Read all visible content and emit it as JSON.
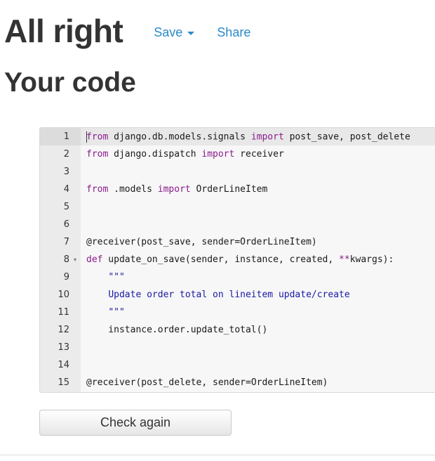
{
  "header": {
    "title": "All right",
    "save_label": "Save",
    "share_label": "Share"
  },
  "subtitle": "Your code",
  "editor": {
    "lines": [
      {
        "n": "1",
        "parts": [
          {
            "t": "from",
            "c": "kw"
          },
          {
            "t": " django.db.models.signals "
          },
          {
            "t": "import",
            "c": "kw"
          },
          {
            "t": " post_save, post_delete"
          }
        ]
      },
      {
        "n": "2",
        "parts": [
          {
            "t": "from",
            "c": "kw"
          },
          {
            "t": " django.dispatch "
          },
          {
            "t": "import",
            "c": "kw"
          },
          {
            "t": " receiver"
          }
        ]
      },
      {
        "n": "3",
        "parts": []
      },
      {
        "n": "4",
        "parts": [
          {
            "t": "from",
            "c": "kw"
          },
          {
            "t": " .models "
          },
          {
            "t": "import",
            "c": "kw"
          },
          {
            "t": " OrderLineItem"
          }
        ]
      },
      {
        "n": "5",
        "parts": []
      },
      {
        "n": "6",
        "parts": []
      },
      {
        "n": "7",
        "parts": [
          {
            "t": "@receiver(post_save, sender"
          },
          {
            "t": "=",
            "c": "op"
          },
          {
            "t": "OrderLineItem)"
          }
        ]
      },
      {
        "n": "8",
        "fold": true,
        "parts": [
          {
            "t": "def",
            "c": "kw"
          },
          {
            "t": " update_on_save(sender, instance, created, "
          },
          {
            "t": "**",
            "c": "kw"
          },
          {
            "t": "kwargs):"
          }
        ]
      },
      {
        "n": "9",
        "parts": [
          {
            "t": "    "
          },
          {
            "t": "\"\"\"",
            "c": "str"
          }
        ]
      },
      {
        "n": "10",
        "parts": [
          {
            "t": "    "
          },
          {
            "t": "Update order total on lineitem update/create",
            "c": "str"
          }
        ]
      },
      {
        "n": "11",
        "parts": [
          {
            "t": "    "
          },
          {
            "t": "\"\"\"",
            "c": "str"
          }
        ]
      },
      {
        "n": "12",
        "parts": [
          {
            "t": "    instance.order.update_total()"
          }
        ]
      },
      {
        "n": "13",
        "parts": []
      },
      {
        "n": "14",
        "parts": []
      },
      {
        "n": "15",
        "parts": [
          {
            "t": "@receiver(post_delete, sender"
          },
          {
            "t": "=",
            "c": "op"
          },
          {
            "t": "OrderLineItem)"
          }
        ]
      }
    ]
  },
  "check_again_label": "Check again",
  "icons": {
    "save_dropdown": "caret-down-icon",
    "fold": "fold-triangle-icon"
  },
  "colors": {
    "link": "#2a8ac8",
    "keyword": "#8b1a8b",
    "string": "#1a1aa6",
    "heading": "#333333"
  }
}
